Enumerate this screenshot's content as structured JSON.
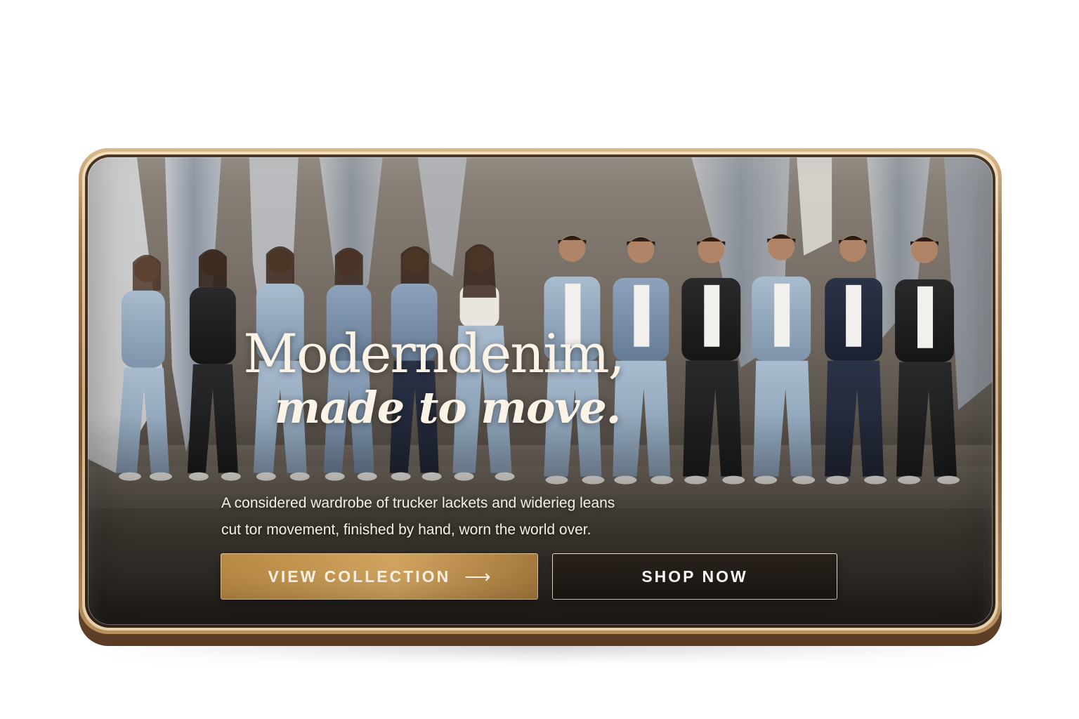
{
  "hero": {
    "headline_line1": "Moderndenim,",
    "headline_line2": "made to move.",
    "subcopy_line1": "A considered wardrobe of trucker lackets and widerieg leans",
    "subcopy_line2": "cut tor movement, finished by hand, worn the world over.",
    "image_description": "group of models in denim jackets and wide-leg jeans walking in a concrete studio"
  },
  "buttons": {
    "primary_label": "VIEW COLLECTION",
    "primary_icon": "arrow-right-icon",
    "primary_arrow": "⟶",
    "secondary_label": "SHOP NOW"
  },
  "colors": {
    "frame_bronze": "#8a6444",
    "accent_gold": "#c99a56",
    "text_cream": "#fbf4e6",
    "dark_button": "#221c17"
  }
}
